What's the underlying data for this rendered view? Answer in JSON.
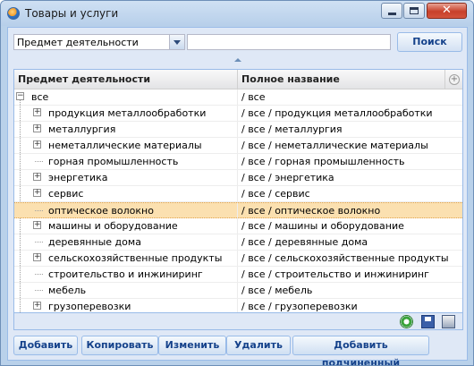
{
  "window": {
    "title": "Товары и услуги",
    "close_glyph": "✕"
  },
  "toolbar": {
    "field_select_value": "Предмет деятельности",
    "search_value": "",
    "search_button": "Поиск"
  },
  "grid": {
    "columns": [
      "Предмет деятельности",
      "Полное название"
    ],
    "rows": [
      {
        "name": "все",
        "path": "/ все",
        "level": 0,
        "toggle": "minus",
        "selected": false
      },
      {
        "name": "продукция металлообработки",
        "path": "/ все / продукция металлообработки",
        "level": 1,
        "toggle": "plus",
        "selected": false
      },
      {
        "name": "металлургия",
        "path": "/ все / металлургия",
        "level": 1,
        "toggle": "plus",
        "selected": false
      },
      {
        "name": "неметаллические материалы",
        "path": "/ все / неметаллические материалы",
        "level": 1,
        "toggle": "plus",
        "selected": false
      },
      {
        "name": "горная промышленность",
        "path": "/ все / горная промышленность",
        "level": 1,
        "toggle": "leaf",
        "selected": false
      },
      {
        "name": "энергетика",
        "path": "/ все / энергетика",
        "level": 1,
        "toggle": "plus",
        "selected": false
      },
      {
        "name": "сервис",
        "path": "/ все / сервис",
        "level": 1,
        "toggle": "plus",
        "selected": false
      },
      {
        "name": "оптическое волокно",
        "path": "/ все / оптическое волокно",
        "level": 1,
        "toggle": "leaf",
        "selected": true
      },
      {
        "name": "машины и оборудование",
        "path": "/ все / машины и оборудование",
        "level": 1,
        "toggle": "plus",
        "selected": false
      },
      {
        "name": "деревянные дома",
        "path": "/ все / деревянные дома",
        "level": 1,
        "toggle": "leaf",
        "selected": false
      },
      {
        "name": "сельскохозяйственные продукты",
        "path": "/ все / сельскохозяйственные продукты",
        "level": 1,
        "toggle": "plus",
        "selected": false
      },
      {
        "name": "строительство и инжиниринг",
        "path": "/ все / строительство и инжиниринг",
        "level": 1,
        "toggle": "leaf",
        "selected": false
      },
      {
        "name": "мебель",
        "path": "/ все / мебель",
        "level": 1,
        "toggle": "leaf",
        "selected": false
      },
      {
        "name": "грузоперевозки",
        "path": "/ все / грузоперевозки",
        "level": 1,
        "toggle": "plus",
        "selected": false
      }
    ],
    "footer_icons": [
      "refresh-icon",
      "save-icon",
      "print-icon"
    ]
  },
  "buttons": {
    "add": "Добавить",
    "copy": "Копировать",
    "edit": "Изменить",
    "delete": "Удалить",
    "add_child": "Добавить подчиненный"
  },
  "colors": {
    "selected_row": "#fbe0b0",
    "header_text": "#15428b"
  }
}
